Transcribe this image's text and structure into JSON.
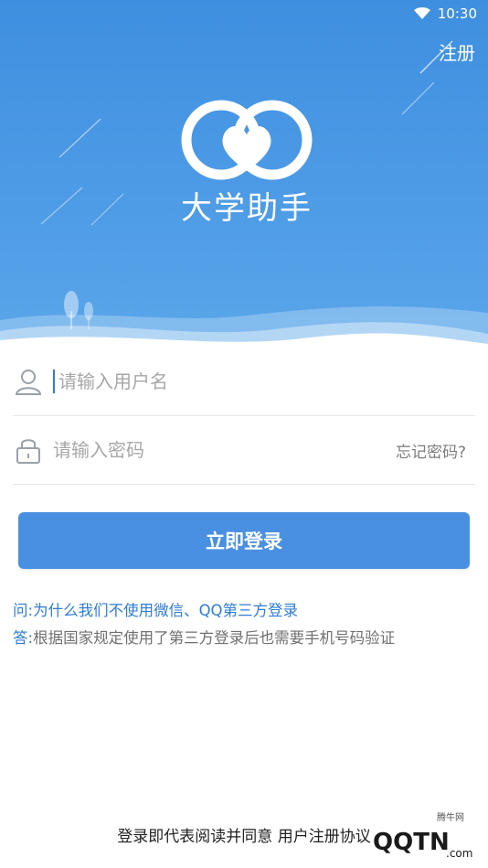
{
  "status_bar": {
    "time": "10:30",
    "icons": [
      "wifi-icon"
    ]
  },
  "header": {
    "register_label": "注册",
    "app_name": "大学助手"
  },
  "form": {
    "username_placeholder": "请输入用户名",
    "password_placeholder": "请输入密码",
    "forgot_label": "忘记密码?",
    "username_icon": "user-icon",
    "password_icon": "lock-icon"
  },
  "login_button_label": "立即登录",
  "faq": {
    "q_label": "问:",
    "q_text": "为什么我们不使用微信、QQ第三方登录",
    "a_label": "答:",
    "a_text": "根据国家规定使用了第三方登录后也需要手机号码验证"
  },
  "agreement_text": "登录即代表阅读并同意 用户注册协议",
  "watermark": {
    "small": "腾牛网",
    "big": "QQTN",
    "suffix": ".com"
  },
  "colors": {
    "header_top": "#3f8fe0",
    "accent": "#4a90e2",
    "link": "#2f7cd6",
    "muted": "#a7a7a7"
  }
}
